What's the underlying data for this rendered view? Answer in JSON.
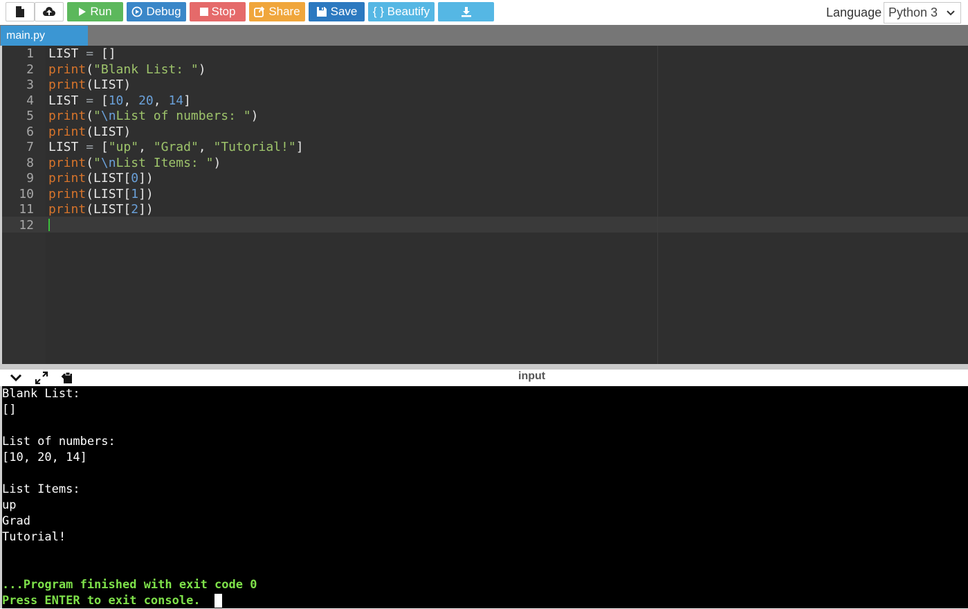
{
  "toolbar": {
    "run_label": "Run",
    "debug_label": "Debug",
    "stop_label": "Stop",
    "share_label": "Share",
    "save_label": "Save",
    "beautify_label": "{ } Beautify",
    "language_label": "Language",
    "language_value": "Python 3"
  },
  "colors": {
    "run": "#5cb85c",
    "debug": "#3a87c8",
    "stop": "#e56a6a",
    "share": "#f0a63c",
    "save": "#2c79c0",
    "beautify": "#55b7e4",
    "download": "#55b7e4"
  },
  "tab": {
    "filename": "main.py"
  },
  "editor": {
    "line_numbers": [
      "1",
      "2",
      "3",
      "4",
      "5",
      "6",
      "7",
      "8",
      "9",
      "10",
      "11",
      "12"
    ]
  },
  "console": {
    "title": "input",
    "output": [
      "Blank List:",
      "[]",
      "",
      "List of numbers:",
      "[10, 20, 14]",
      "",
      "List Items:",
      "up",
      "Grad",
      "Tutorial!",
      "",
      ""
    ],
    "finished": "...Program finished with exit code 0",
    "press_enter": "Press ENTER to exit console."
  }
}
